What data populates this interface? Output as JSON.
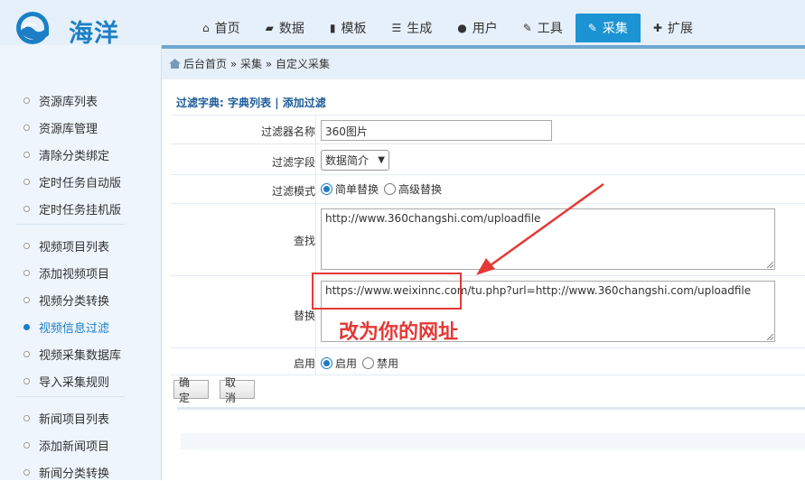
{
  "brand": {
    "name": "海洋",
    "accent": "#1c93d3"
  },
  "nav": [
    {
      "label": "首页",
      "icon": "home-icon",
      "glyph": "⌂"
    },
    {
      "label": "数据",
      "icon": "book-icon",
      "glyph": "▰"
    },
    {
      "label": "模板",
      "icon": "file-icon",
      "glyph": "▮"
    },
    {
      "label": "生成",
      "icon": "server-icon",
      "glyph": "☰"
    },
    {
      "label": "用户",
      "icon": "user-icon",
      "glyph": "●"
    },
    {
      "label": "工具",
      "icon": "wrench-icon",
      "glyph": "✎"
    },
    {
      "label": "采集",
      "icon": "edit-icon",
      "glyph": "✎",
      "active": true
    },
    {
      "label": "扩展",
      "icon": "puzzle-icon",
      "glyph": "✚"
    }
  ],
  "breadcrumb": "后台首页 » 采集 » 自定义采集",
  "sidebar": {
    "items": [
      {
        "label": "资源库列表"
      },
      {
        "label": "资源库管理"
      },
      {
        "label": "清除分类绑定"
      },
      {
        "label": "定时任务自动版"
      },
      {
        "label": "定时任务挂机版"
      },
      {
        "label": "视频项目列表"
      },
      {
        "label": "添加视频项目"
      },
      {
        "label": "视频分类转换"
      },
      {
        "label": "视频信息过滤",
        "active": true
      },
      {
        "label": "视频采集数据库"
      },
      {
        "label": "导入采集规则"
      },
      {
        "label": "新闻项目列表"
      },
      {
        "label": "添加新闻项目"
      },
      {
        "label": "新闻分类转换"
      }
    ]
  },
  "form": {
    "title_prefix": "过滤字典:",
    "title_link1": "字典列表",
    "title_sep": "|",
    "title_link2": "添加过滤",
    "filter_name_label": "过滤器名称",
    "filter_name_value": "360图片",
    "filter_field_label": "过滤字段",
    "filter_field_value": "数据简介",
    "filter_mode_label": "过滤模式",
    "mode_simple": "简单替换",
    "mode_advanced": "高级替换",
    "find_label": "查找",
    "find_value": "http://www.360changshi.com/uploadfile",
    "replace_label": "替换",
    "replace_value": "https://www.weixinnc.com/tu.php?url=http://www.360changshi.com/uploadfile",
    "enable_label": "启用",
    "enable_on": "启用",
    "enable_off": "禁用",
    "confirm_label": "确定",
    "cancel_label": "取消"
  },
  "annotation": {
    "text": "改为你的网址",
    "color": "#e53935"
  }
}
